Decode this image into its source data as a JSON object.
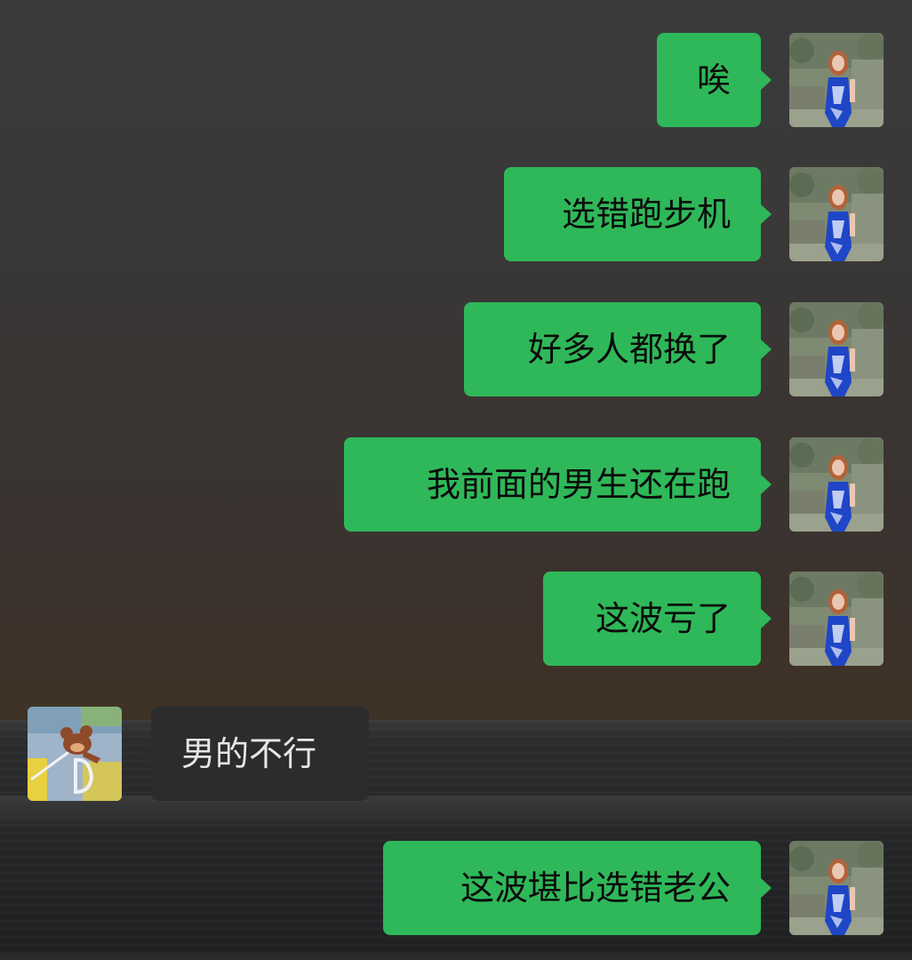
{
  "chat": {
    "messages": [
      {
        "side": "sent",
        "text": "唉"
      },
      {
        "side": "sent",
        "text": "选错跑步机"
      },
      {
        "side": "sent",
        "text": "好多人都换了"
      },
      {
        "side": "sent",
        "text": "我前面的男生还在跑"
      },
      {
        "side": "sent",
        "text": "这波亏了"
      },
      {
        "side": "received",
        "text": "男的不行"
      },
      {
        "side": "sent",
        "text": "这波堪比选错老公"
      }
    ]
  },
  "avatars": {
    "self": "woman-in-blue-dress-avatar",
    "other": "cartoon-mouse-avatar"
  },
  "colors": {
    "sent_bubble": "#2fb859",
    "received_bubble": "#2c2c2c"
  }
}
